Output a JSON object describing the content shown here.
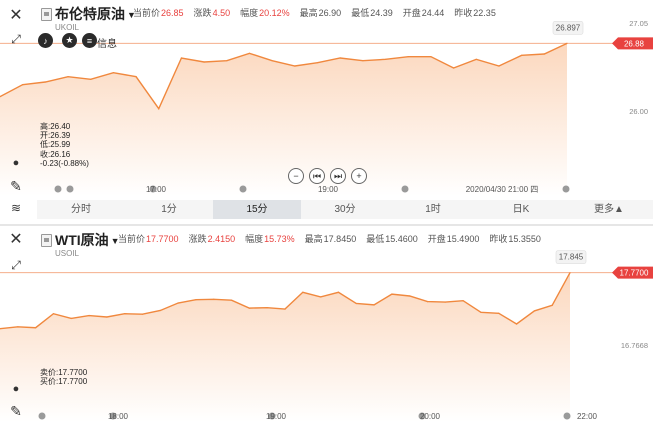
{
  "top": {
    "name": "布伦特原油",
    "code": "UKOIL",
    "quotes": [
      {
        "label": "当前价",
        "value": "26.85",
        "color": "#e8423f"
      },
      {
        "label": "涨跌",
        "value": "4.50",
        "color": "#e8423f"
      },
      {
        "label": "幅度",
        "value": "20.12%",
        "color": "#e8423f"
      },
      {
        "label": "最高",
        "value": "26.90",
        "color": "#555555"
      },
      {
        "label": "最低",
        "value": "24.39",
        "color": "#555555"
      },
      {
        "label": "开盘",
        "value": "24.44",
        "color": "#555555"
      },
      {
        "label": "昨收",
        "value": "22.35",
        "color": "#555555"
      }
    ],
    "info_label": "信息",
    "ohlc": [
      "高:26.40",
      "开:26.39",
      "低:25.99",
      "收:26.16",
      "-0.23(-0.88%)"
    ],
    "tabs": [
      "分时",
      "1分",
      "15分",
      "30分",
      "1时",
      "日K",
      "更多▲"
    ],
    "active_tab": "15分"
  },
  "bottom": {
    "name": "WTI原油",
    "code": "USOIL",
    "quotes": [
      {
        "label": "当前价",
        "value": "17.7700",
        "color": "#e8423f"
      },
      {
        "label": "涨跌",
        "value": "2.4150",
        "color": "#e8423f"
      },
      {
        "label": "幅度",
        "value": "15.73%",
        "color": "#e8423f"
      },
      {
        "label": "最高",
        "value": "17.8450",
        "color": "#555555"
      },
      {
        "label": "最低",
        "value": "15.4600",
        "color": "#555555"
      },
      {
        "label": "开盘",
        "value": "15.4900",
        "color": "#555555"
      },
      {
        "label": "昨收",
        "value": "15.3550",
        "color": "#555555"
      }
    ],
    "bid": "卖价:17.7700",
    "ask": "买价:17.7700"
  },
  "chart_data": [
    {
      "type": "area",
      "title": "布伦特原油",
      "x_ticks": [
        "17:00",
        "19:00",
        "2020/04/30 21:00 四"
      ],
      "y_ticks": [
        "27.05",
        "26.00"
      ],
      "last_value_label": "26.897",
      "current_price_label": "26.88",
      "y_range": [
        25.3,
        27.1
      ],
      "values": [
        26.1,
        26.28,
        26.32,
        26.4,
        26.36,
        26.46,
        26.4,
        25.92,
        26.68,
        26.62,
        26.64,
        26.75,
        26.64,
        26.56,
        26.61,
        26.68,
        26.64,
        26.66,
        26.7,
        26.7,
        26.53,
        26.66,
        26.56,
        26.72,
        26.74,
        26.9
      ],
      "colors": {
        "line": "#f0883e",
        "fill": "#fbe3d1",
        "tag": "#e8423f"
      }
    },
    {
      "type": "area",
      "title": "WTI原油",
      "x_ticks": [
        "18:00",
        "19:00",
        "20:00",
        "22:00"
      ],
      "y_ticks": [
        "16.7668"
      ],
      "last_value_label": "17.845",
      "current_price_label": "17.7700",
      "y_range": [
        15.8,
        18.2
      ],
      "values": [
        16.6,
        16.64,
        16.62,
        16.92,
        16.82,
        16.88,
        16.85,
        16.92,
        16.91,
        16.99,
        17.15,
        17.22,
        17.23,
        17.21,
        17.04,
        17.05,
        17.02,
        17.38,
        17.28,
        17.38,
        17.14,
        17.11,
        17.34,
        17.3,
        17.18,
        17.17,
        17.2,
        16.95,
        16.93,
        16.7,
        16.98,
        17.1,
        17.8
      ],
      "colors": {
        "line": "#f0883e",
        "fill": "#fbe3d1",
        "tag": "#e8423f"
      }
    }
  ]
}
